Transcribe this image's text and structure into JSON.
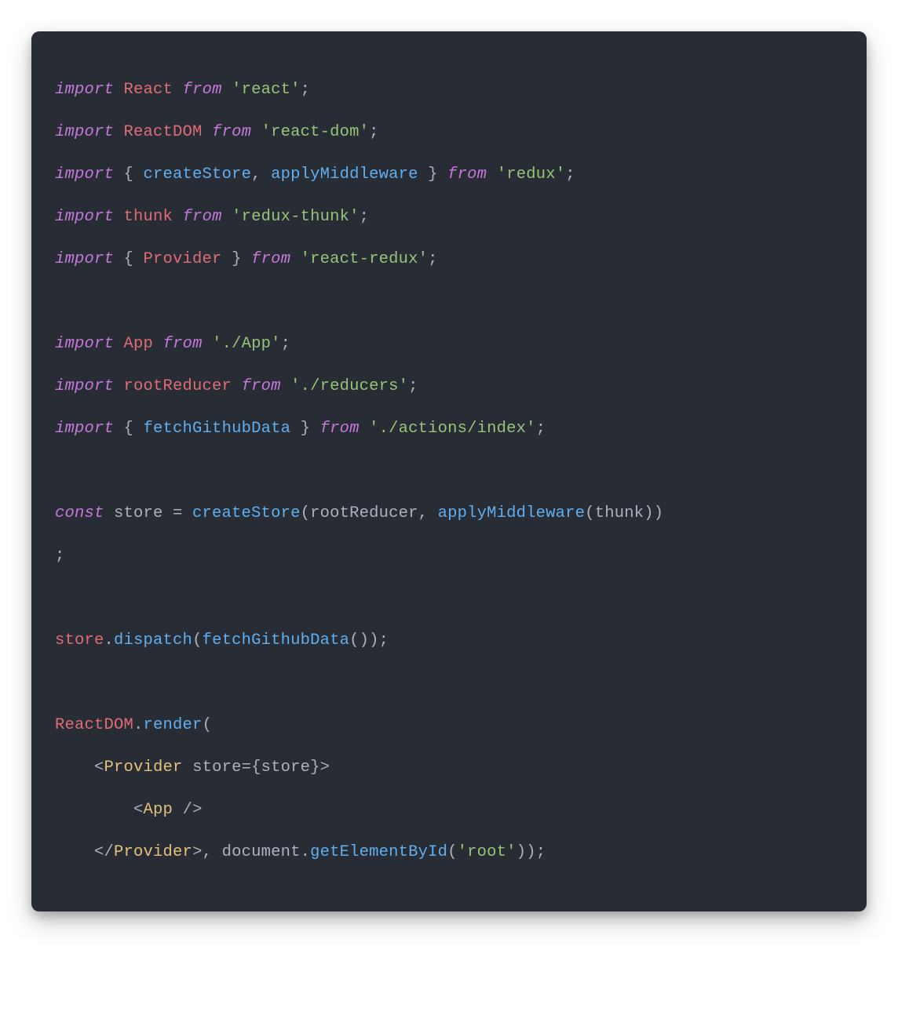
{
  "code": {
    "line1_import": "import",
    "line1_react": "React",
    "line1_from": "from",
    "line1_str": "'react'",
    "line1_semi": ";",
    "line2_import": "import",
    "line2_reactdom": "ReactDOM",
    "line2_from": "from",
    "line2_str": "'react-dom'",
    "line2_semi": ";",
    "line3_import": "import",
    "line3_lbrace": "{ ",
    "line3_createStore": "createStore",
    "line3_comma": ", ",
    "line3_applyMiddleware": "applyMiddleware",
    "line3_rbrace": " }",
    "line3_from": "from",
    "line3_str": "'redux'",
    "line3_semi": ";",
    "line4_import": "import",
    "line4_thunk": "thunk",
    "line4_from": "from",
    "line4_str": "'redux-thunk'",
    "line4_semi": ";",
    "line5_import": "import",
    "line5_lbrace": "{ ",
    "line5_provider": "Provider",
    "line5_rbrace": " }",
    "line5_from": "from",
    "line5_str": "'react-redux'",
    "line5_semi": ";",
    "blank1": " ",
    "line6_import": "import",
    "line6_app": "App",
    "line6_from": "from",
    "line6_str": "'./App'",
    "line6_semi": ";",
    "line7_import": "import",
    "line7_rootReducer": "rootReducer",
    "line7_from": "from",
    "line7_str": "'./reducers'",
    "line7_semi": ";",
    "line8_import": "import",
    "line8_lbrace": "{ ",
    "line8_fetch": "fetchGithubData",
    "line8_rbrace": " }",
    "line8_from": "from",
    "line8_str": "'./actions/index'",
    "line8_semi": ";",
    "blank2": " ",
    "line9_const": "const",
    "line9_store": " store = ",
    "line9_createStore": "createStore",
    "line9_lparen": "(",
    "line9_rootReducer": "rootReducer",
    "line9_comma": ", ",
    "line9_applyMiddleware": "applyMiddleware",
    "line9_lparen2": "(",
    "line9_thunk": "thunk",
    "line9_rparen2": "))",
    "line9b_semi": ";",
    "blank3": " ",
    "line10_store": "store",
    "line10_dot": ".",
    "line10_dispatch": "dispatch",
    "line10_lparen": "(",
    "line10_fetch": "fetchGithubData",
    "line10_parens": "())",
    "line10_semi": ";",
    "blank4": " ",
    "line11_reactdom": "ReactDOM",
    "line11_dot": ".",
    "line11_render": "render",
    "line11_lparen": "(",
    "line12_indent": "    ",
    "line12_lt": "<",
    "line12_provider": "Provider",
    "line12_storeattr": " store={store}>",
    "line13_indent": "        ",
    "line13_lt": "<",
    "line13_app": "App",
    "line13_close": " />",
    "line14_indent": "    ",
    "line14_lt": "</",
    "line14_provider": "Provider",
    "line14_gt": ">, ",
    "line14_document": "document",
    "line14_dot": ".",
    "line14_getElementById": "getElementById",
    "line14_lparen": "(",
    "line14_root": "'root'",
    "line14_end": "));"
  }
}
